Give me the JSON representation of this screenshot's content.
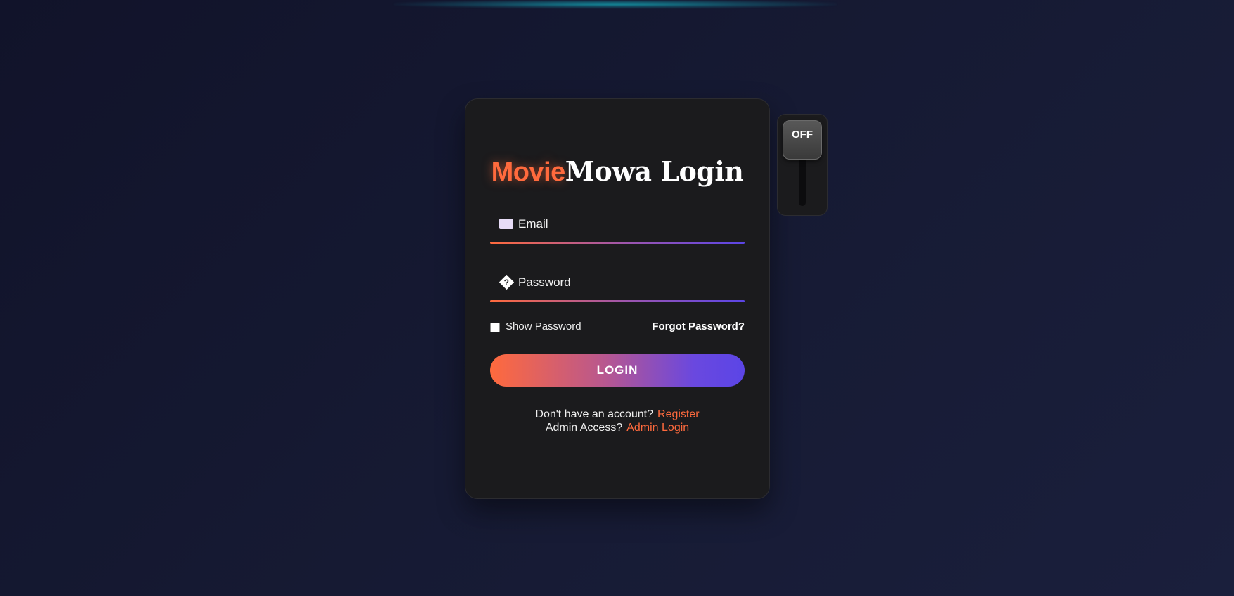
{
  "login": {
    "title_brand": "Movie",
    "title_rest": "Mowa Login",
    "email_placeholder": "Email",
    "email_icon": "mail-icon",
    "password_placeholder": "Password",
    "password_icon": "lock-icon",
    "show_password_label": "Show Password",
    "show_password_checked": false,
    "forgot_password_label": "Forgot Password?",
    "login_button_label": "LOGIN",
    "register_prompt": "Don't have an account?",
    "register_link": "Register",
    "admin_prompt": "Admin Access?",
    "admin_link": "Admin Login"
  },
  "toggle": {
    "state_label": "OFF"
  },
  "colors": {
    "accent": "#ff6a3d",
    "gradient_end": "#5b45e6",
    "card_bg": "#1b1b1d",
    "page_bg": "#161a33"
  }
}
